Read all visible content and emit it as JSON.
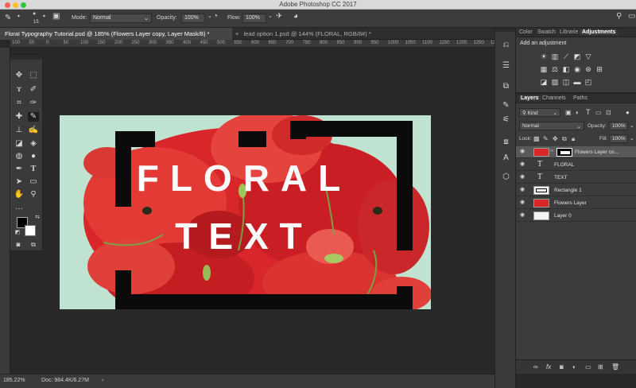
{
  "app": {
    "title": "Adobe Photoshop CC 2017"
  },
  "options": {
    "brush_size": "15",
    "mode_label": "Mode:",
    "mode_value": "Normal",
    "opacity_label": "Opacity:",
    "opacity_value": "100%",
    "flow_label": "Flow:",
    "flow_value": "100%"
  },
  "tabs": [
    {
      "label": "Floral Typography Tutorial.psd @ 185% (Flowers Layer copy, Layer Mask/8) *",
      "close": "×"
    },
    {
      "label": "lead option 1.psd @ 144% (FLORAL, RGB/8#) *",
      "close": "×"
    }
  ],
  "ruler": {
    "top": [
      "100",
      "50",
      "0",
      "50",
      "100",
      "150",
      "200",
      "250",
      "300",
      "350",
      "400",
      "450",
      "500",
      "550",
      "600",
      "650",
      "700",
      "750",
      "800",
      "850",
      "900",
      "950",
      "1000",
      "1050",
      "1100",
      "1150",
      "1200",
      "1250",
      "1300"
    ]
  },
  "canvas": {
    "line1": "FLORAL",
    "line2": "TEXT"
  },
  "status": {
    "zoom": "185.22%",
    "doc": "Doc: 984.4K/6.27M",
    "arrow": "›"
  },
  "panels": {
    "top_tabs": [
      "Color",
      "Swatch",
      "Librarie",
      "Adjustments"
    ],
    "add_adjustment": "Add an adjustment",
    "layer_tabs": [
      "Layers",
      "Channels",
      "Paths"
    ],
    "kind_label": "Kind",
    "blend_mode": "Normal",
    "opacity_label": "Opacity:",
    "opacity_value": "100%",
    "lock_label": "Lock:",
    "fill_label": "Fill:",
    "fill_value": "100%"
  },
  "layers": [
    {
      "name": "Flowers Layer co...",
      "type": "image-mask",
      "selected": true
    },
    {
      "name": "FLORAL",
      "type": "text",
      "selected": false
    },
    {
      "name": "TEXT",
      "type": "text",
      "selected": false
    },
    {
      "name": "Rectangle 1",
      "type": "shape",
      "selected": false
    },
    {
      "name": "Flowers Layer",
      "type": "image",
      "selected": false
    },
    {
      "name": "Layer 0",
      "type": "fill",
      "selected": false
    }
  ],
  "colors": {
    "canvas_bg": "#bfe3d0",
    "poppy_red": "#d8262a",
    "frame": "#0b0b0b"
  }
}
